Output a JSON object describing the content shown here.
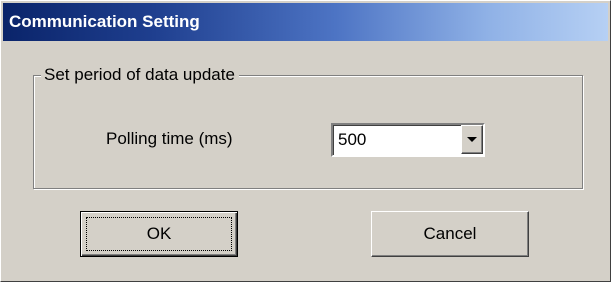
{
  "window": {
    "title": "Communication Setting"
  },
  "group": {
    "legend": "Set period of data update",
    "polling_label": "Polling time (ms)",
    "polling_value": "500"
  },
  "buttons": {
    "ok_label": "OK",
    "cancel_label": "Cancel"
  },
  "icons": {
    "dropdown": "chevron-down-icon"
  },
  "colors": {
    "titlebar_start": "#0a246a",
    "titlebar_end": "#b6d0f4",
    "face": "#d4d0c8"
  }
}
